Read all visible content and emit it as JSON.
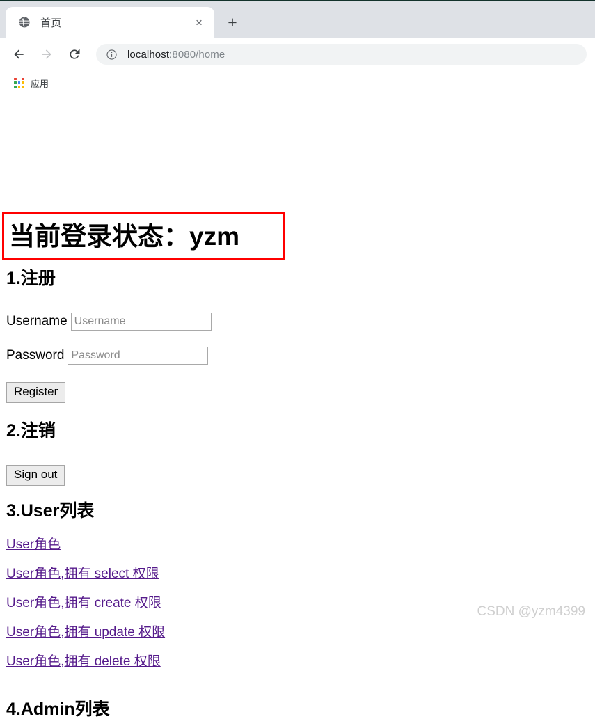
{
  "browser": {
    "tab": {
      "title": "首页",
      "favicon_icon": "globe-icon",
      "close_icon": "×"
    },
    "new_tab_icon": "+",
    "nav": {
      "back_icon": "arrow-left-icon",
      "forward_icon": "arrow-right-icon",
      "reload_icon": "reload-icon"
    },
    "omnibox": {
      "info_icon": "info-circle-icon",
      "url_host": "localhost",
      "url_rest": ":8080/home"
    },
    "bookmarks": {
      "apps_icon": "apps-grid-icon",
      "apps_label": "应用",
      "apps_colors": [
        "#ea4335",
        "#ffffff",
        "#ea4335",
        "#34a853",
        "#4285f4",
        "#fbbc05",
        "#34a853",
        "#fbbc05",
        "#fbbc05"
      ]
    }
  },
  "page": {
    "status": {
      "text": "当前登录状态：yzm",
      "border_color": "#ff0000"
    },
    "sections": {
      "register_heading": "1.注册",
      "signout_heading": "2.注销",
      "userlist_heading": "3.User列表",
      "adminlist_heading": "4.Admin列表"
    },
    "form": {
      "username_label": "Username",
      "username_placeholder": "Username",
      "username_value": "",
      "password_label": "Password",
      "password_placeholder": "Password",
      "password_value": "",
      "register_button": "Register",
      "signout_button": "Sign out"
    },
    "user_links": [
      {
        "text": "User角色"
      },
      {
        "text": "User角色,拥有 select 权限"
      },
      {
        "text": "User角色,拥有 create 权限"
      },
      {
        "text": "User角色,拥有 update 权限"
      },
      {
        "text": "User角色,拥有 delete 权限"
      }
    ],
    "link_color": "#551a8b",
    "watermark": "CSDN @yzm4399"
  }
}
